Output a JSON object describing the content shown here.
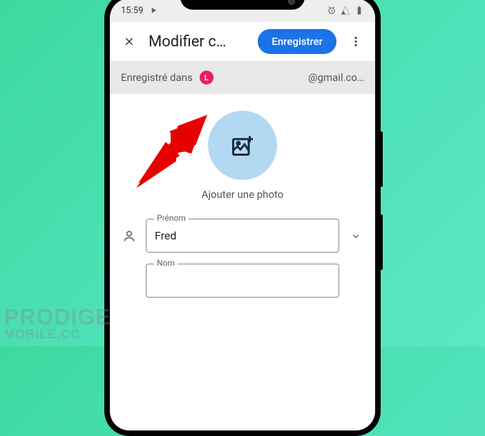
{
  "status_bar": {
    "time": "15:59"
  },
  "app_bar": {
    "title": "Modifier c…",
    "save_label": "Enregistrer"
  },
  "account_row": {
    "saved_in": "Enregistré dans",
    "avatar_letter": "L",
    "email": "@gmail.co…"
  },
  "photo": {
    "caption": "Ajouter une photo"
  },
  "form": {
    "firstname_label": "Prénom",
    "firstname_value": "Fred",
    "lastname_label": "Nom"
  },
  "watermark": {
    "line1": "PRODIGE",
    "line2": "MOBILE.CC"
  }
}
